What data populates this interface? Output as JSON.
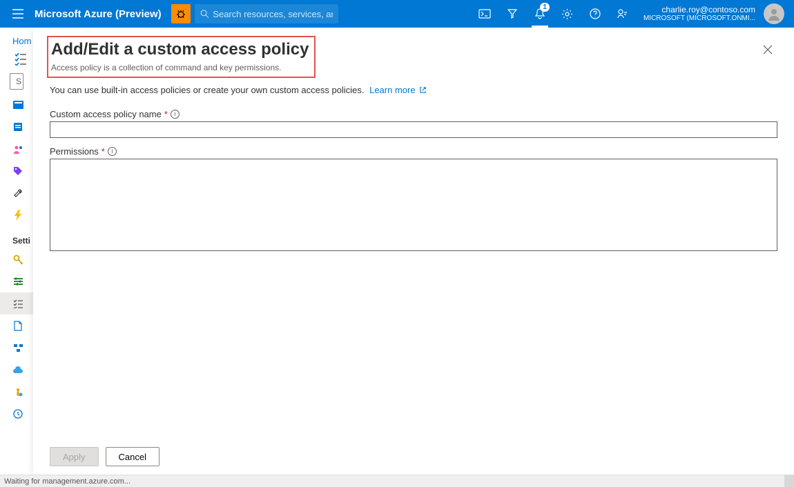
{
  "header": {
    "brand": "Microsoft Azure (Preview)",
    "search_placeholder": "Search resources, services, and docs (G+/)",
    "notification_count": "1",
    "account_email": "charlie.roy@contoso.com",
    "account_tenant": "MICROSOFT (MICROSOFT.ONMI..."
  },
  "breadcrumb": {
    "home": "Hom"
  },
  "sidebar": {
    "section_label": "Setti",
    "search_placeholder": "S"
  },
  "panel": {
    "title": "Add/Edit a custom access policy",
    "subtitle": "Access policy is a collection of command and key permissions.",
    "intro_text": "You can use built-in access policies or create your own custom access policies.",
    "learn_more": "Learn more",
    "field_name_label": "Custom access policy name",
    "field_permissions_label": "Permissions",
    "name_value": "",
    "permissions_value": "",
    "apply_label": "Apply",
    "cancel_label": "Cancel"
  },
  "status": {
    "text": "Waiting for management.azure.com..."
  }
}
